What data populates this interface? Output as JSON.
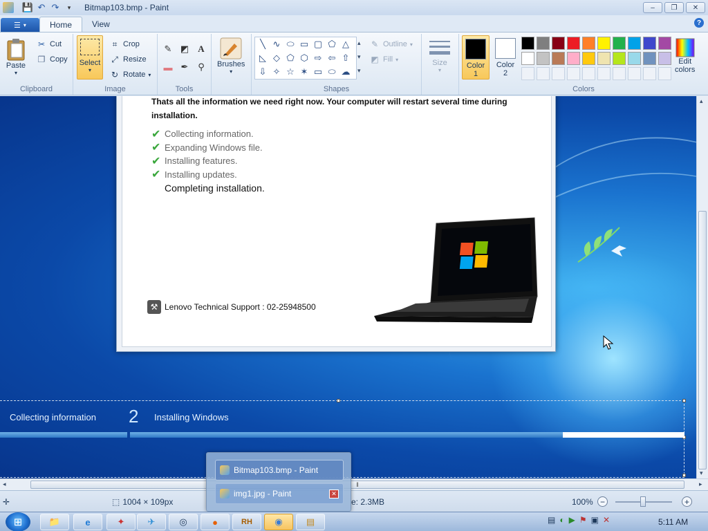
{
  "titlebar": {
    "title": "Bitmap103.bmp - Paint"
  },
  "tabs": {
    "home": "Home",
    "view": "View"
  },
  "ribbon": {
    "clipboard": {
      "group": "Clipboard",
      "paste": "Paste",
      "cut": "Cut",
      "copy": "Copy"
    },
    "image": {
      "group": "Image",
      "select": "Select",
      "crop": "Crop",
      "resize": "Resize",
      "rotate": "Rotate"
    },
    "tools": {
      "group": "Tools"
    },
    "brushes": {
      "label": "Brushes"
    },
    "shapes": {
      "group": "Shapes",
      "outline": "Outline",
      "fill": "Fill"
    },
    "size": {
      "label": "Size"
    },
    "colors": {
      "group": "Colors",
      "color1_label": "Color",
      "color1_num": "1",
      "color2_label": "Color",
      "color2_num": "2",
      "edit_label": "Edit",
      "edit_label2": "colors",
      "color1": "#000000",
      "color2": "#ffffff",
      "palette_row1": [
        "#000000",
        "#7f7f7f",
        "#880015",
        "#ed1c24",
        "#ff7f27",
        "#fff200",
        "#22b14c",
        "#00a2e8",
        "#3f48cc",
        "#a349a4"
      ],
      "palette_row2": [
        "#ffffff",
        "#c3c3c3",
        "#b97a57",
        "#ffaec9",
        "#ffc90e",
        "#efe4b0",
        "#b5e61d",
        "#99d9ea",
        "#7092be",
        "#c8bfe7"
      ]
    }
  },
  "canvas": {
    "intro": "Thats all the information we need right now. Your computer will restart several time during installation.",
    "steps": [
      {
        "text": "Collecting information."
      },
      {
        "text": "Expanding Windows file."
      },
      {
        "text": "Installing features."
      },
      {
        "text": "Installing updates."
      }
    ],
    "current_step": "Completing installation.",
    "support": "Lenovo Technical Support : 02-25948500",
    "setup_step1_label": "Collecting information",
    "setup_step2_num": "2",
    "setup_step2_label": "Installing Windows",
    "progress": 0.78
  },
  "status": {
    "dimensions": "1004 × 109px",
    "size_partial": "e: 2.3MB",
    "zoom": "100%"
  },
  "popup": {
    "item1": "Bitmap103.bmp - Paint",
    "item2": "img1.jpg - Paint"
  },
  "taskbar": {
    "clock": "5:11 AM"
  }
}
